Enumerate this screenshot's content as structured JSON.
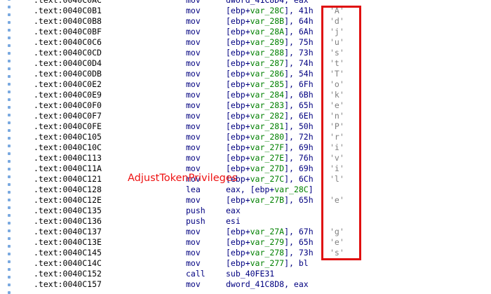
{
  "annotation": {
    "label": "AdjustTokenPrivileges",
    "color": "#ee1111",
    "box_color": "#e01010"
  },
  "colors": {
    "address": "#000000",
    "mnemonic": "#000080",
    "variable": "#008000",
    "char": "#808080",
    "gutter_dot": "#7aa9e0"
  },
  "rows": [
    {
      "addr": ".text:0040C0AC",
      "mnem": "mov",
      "pre": "dword_41C8D4, eax",
      "var": "",
      "post": "",
      "chr": ""
    },
    {
      "addr": ".text:0040C0B1",
      "mnem": "mov",
      "pre": "[ebp+",
      "var": "var_28C",
      "post": "], 41h",
      "chr": "'A'"
    },
    {
      "addr": ".text:0040C0B8",
      "mnem": "mov",
      "pre": "[ebp+",
      "var": "var_28B",
      "post": "], 64h",
      "chr": "'d'"
    },
    {
      "addr": ".text:0040C0BF",
      "mnem": "mov",
      "pre": "[ebp+",
      "var": "var_28A",
      "post": "], 6Ah",
      "chr": "'j'"
    },
    {
      "addr": ".text:0040C0C6",
      "mnem": "mov",
      "pre": "[ebp+",
      "var": "var_289",
      "post": "], 75h",
      "chr": "'u'"
    },
    {
      "addr": ".text:0040C0CD",
      "mnem": "mov",
      "pre": "[ebp+",
      "var": "var_288",
      "post": "], 73h",
      "chr": "'s'"
    },
    {
      "addr": ".text:0040C0D4",
      "mnem": "mov",
      "pre": "[ebp+",
      "var": "var_287",
      "post": "], 74h",
      "chr": "'t'"
    },
    {
      "addr": ".text:0040C0DB",
      "mnem": "mov",
      "pre": "[ebp+",
      "var": "var_286",
      "post": "], 54h",
      "chr": "'T'"
    },
    {
      "addr": ".text:0040C0E2",
      "mnem": "mov",
      "pre": "[ebp+",
      "var": "var_285",
      "post": "], 6Fh",
      "chr": "'o'"
    },
    {
      "addr": ".text:0040C0E9",
      "mnem": "mov",
      "pre": "[ebp+",
      "var": "var_284",
      "post": "], 6Bh",
      "chr": "'k'"
    },
    {
      "addr": ".text:0040C0F0",
      "mnem": "mov",
      "pre": "[ebp+",
      "var": "var_283",
      "post": "], 65h",
      "chr": "'e'"
    },
    {
      "addr": ".text:0040C0F7",
      "mnem": "mov",
      "pre": "[ebp+",
      "var": "var_282",
      "post": "], 6Eh",
      "chr": "'n'"
    },
    {
      "addr": ".text:0040C0FE",
      "mnem": "mov",
      "pre": "[ebp+",
      "var": "var_281",
      "post": "], 50h",
      "chr": "'P'"
    },
    {
      "addr": ".text:0040C105",
      "mnem": "mov",
      "pre": "[ebp+",
      "var": "var_280",
      "post": "], 72h",
      "chr": "'r'"
    },
    {
      "addr": ".text:0040C10C",
      "mnem": "mov",
      "pre": "[ebp+",
      "var": "var_27F",
      "post": "], 69h",
      "chr": "'i'"
    },
    {
      "addr": ".text:0040C113",
      "mnem": "mov",
      "pre": "[ebp+",
      "var": "var_27E",
      "post": "], 76h",
      "chr": "'v'"
    },
    {
      "addr": ".text:0040C11A",
      "mnem": "mov",
      "pre": "[ebp+",
      "var": "var_27D",
      "post": "], 69h",
      "chr": "'i'"
    },
    {
      "addr": ".text:0040C121",
      "mnem": "mov",
      "pre": "[ebp+",
      "var": "var_27C",
      "post": "], 6Ch",
      "chr": "'l'"
    },
    {
      "addr": ".text:0040C128",
      "mnem": "lea",
      "pre": "eax, [ebp+",
      "var": "var_28C",
      "post": "]",
      "chr": ""
    },
    {
      "addr": ".text:0040C12E",
      "mnem": "mov",
      "pre": "[ebp+",
      "var": "var_27B",
      "post": "], 65h",
      "chr": "'e'"
    },
    {
      "addr": ".text:0040C135",
      "mnem": "push",
      "pre": "eax",
      "var": "",
      "post": "",
      "chr": ""
    },
    {
      "addr": ".text:0040C136",
      "mnem": "push",
      "pre": "esi",
      "var": "",
      "post": "",
      "chr": ""
    },
    {
      "addr": ".text:0040C137",
      "mnem": "mov",
      "pre": "[ebp+",
      "var": "var_27A",
      "post": "], 67h",
      "chr": "'g'"
    },
    {
      "addr": ".text:0040C13E",
      "mnem": "mov",
      "pre": "[ebp+",
      "var": "var_279",
      "post": "], 65h",
      "chr": "'e'"
    },
    {
      "addr": ".text:0040C145",
      "mnem": "mov",
      "pre": "[ebp+",
      "var": "var_278",
      "post": "], 73h",
      "chr": "'s'"
    },
    {
      "addr": ".text:0040C14C",
      "mnem": "mov",
      "pre": "[ebp+",
      "var": "var_277",
      "post": "], bl",
      "chr": ""
    },
    {
      "addr": ".text:0040C152",
      "mnem": "call",
      "pre": "sub_40FE31",
      "var": "",
      "post": "",
      "chr": ""
    },
    {
      "addr": ".text:0040C157",
      "mnem": "mov",
      "pre": "dword_41C8D8, eax",
      "var": "",
      "post": "",
      "chr": ""
    }
  ]
}
